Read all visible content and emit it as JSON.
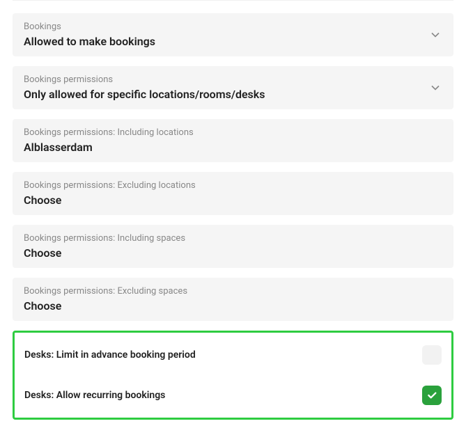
{
  "settings": [
    {
      "label": "Bookings",
      "value": "Allowed to make bookings",
      "hasChevron": true
    },
    {
      "label": "Bookings permissions",
      "value": "Only allowed for specific locations/rooms/desks",
      "hasChevron": true
    },
    {
      "label": "Bookings permissions: Including locations",
      "value": "Alblasserdam",
      "hasChevron": false
    },
    {
      "label": "Bookings permissions: Excluding locations",
      "value": "Choose",
      "hasChevron": false
    },
    {
      "label": "Bookings permissions: Including spaces",
      "value": "Choose",
      "hasChevron": false
    },
    {
      "label": "Bookings permissions: Excluding spaces",
      "value": "Choose",
      "hasChevron": false
    }
  ],
  "toggles": {
    "limitAdvance": {
      "label": "Desks: Limit in advance booking period",
      "enabled": false
    },
    "allowRecurring": {
      "label": "Desks: Allow recurring bookings",
      "enabled": true
    }
  }
}
